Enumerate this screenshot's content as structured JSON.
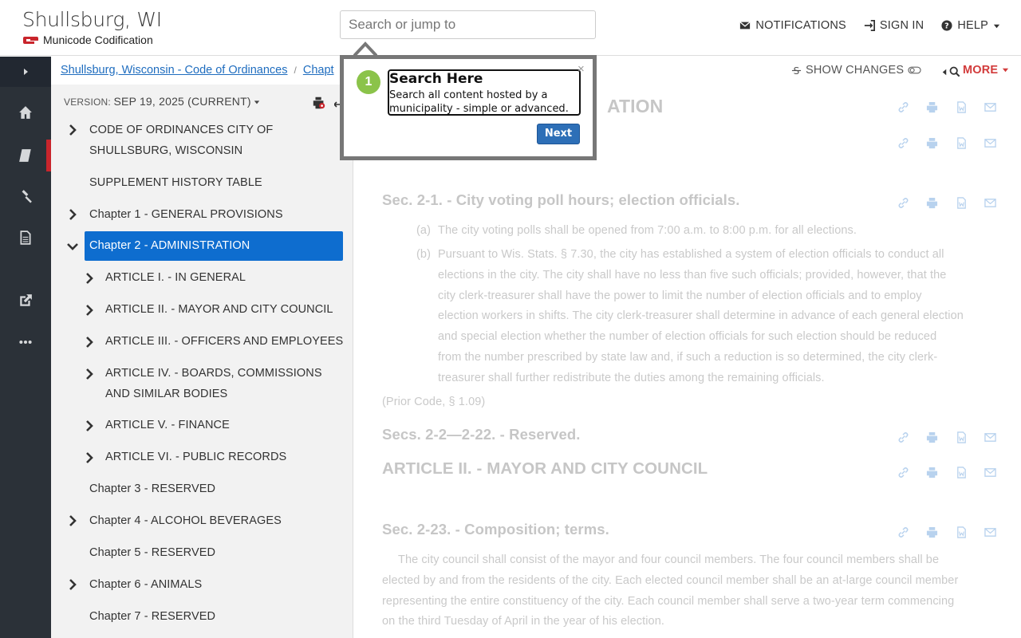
{
  "header": {
    "site_title": "Shullsburg, WI",
    "brand": "Municode Codification",
    "search_placeholder": "Search or jump to",
    "nav": {
      "notifications": "NOTIFICATIONS",
      "sign_in": "SIGN IN",
      "help": "HELP"
    }
  },
  "breadcrumb": {
    "root": "Shullsburg, Wisconsin - Code of Ordinances",
    "sep": "/",
    "current": "Chapt"
  },
  "toolbar": {
    "show_changes": "SHOW CHANGES",
    "more": "MORE"
  },
  "toc": {
    "version_label": "VERSION:",
    "version_value": "SEP 19, 2025 (CURRENT)",
    "items": [
      {
        "label_1": "CODE OF ORDINANCES CITY OF",
        "label_2": "SHULLSBURG, WISCONSIN"
      },
      {
        "label": "SUPPLEMENT HISTORY TABLE"
      },
      {
        "label": "Chapter 1 - GENERAL PROVISIONS"
      },
      {
        "label": "Chapter 2 - ADMINISTRATION"
      },
      {
        "label": "ARTICLE I. - IN GENERAL"
      },
      {
        "label": "ARTICLE II. - MAYOR AND CITY COUNCIL"
      },
      {
        "label": "ARTICLE III. - OFFICERS AND EMPLOYEES"
      },
      {
        "label_1": "ARTICLE IV. - BOARDS, COMMISSIONS",
        "label_2": "AND SIMILAR BODIES"
      },
      {
        "label": "ARTICLE V. - FINANCE"
      },
      {
        "label": "ARTICLE VI. - PUBLIC RECORDS"
      },
      {
        "label": "Chapter 3 - RESERVED"
      },
      {
        "label": "Chapter 4 - ALCOHOL BEVERAGES"
      },
      {
        "label": "Chapter 5 - RESERVED"
      },
      {
        "label": "Chapter 6 - ANIMALS"
      },
      {
        "label": "Chapter 7 - RESERVED"
      }
    ]
  },
  "document": {
    "chapter_title_fragment": "ATION",
    "sec_2_1_title": "Sec. 2-1. - City voting poll hours; election officials.",
    "sec_2_1_a_label": "(a)",
    "sec_2_1_a": "The city voting polls shall be opened from 7:00 a.m. to 8:00 p.m. for all elections.",
    "sec_2_1_b_label": "(b)",
    "sec_2_1_b_lines": [
      "Pursuant to Wis. Stats. § 7.30, the city has established a system of election officials to conduct all",
      "elections in the city. The city shall have no less than five such officials; provided, however, that the",
      "city clerk-treasurer shall have the power to limit the number of election officials and to employ",
      "election workers in shifts. The city clerk-treasurer shall determine in advance of each general election",
      "and special election whether the number of election officials for such election should be reduced",
      "from the number prescribed by state law and, if such a reduction is so determined, the city clerk-",
      "treasurer shall further redistribute the duties among the remaining officials."
    ],
    "prior_code": "(Prior Code, § 1.09)",
    "secs_reserved": "Secs. 2-2—2-22. - Reserved.",
    "article_ii": "ARTICLE II. - MAYOR AND CITY COUNCIL",
    "sec_2_23_title": "Sec. 2-23. - Composition; terms.",
    "sec_2_23_lines": [
      "The city council shall consist of the mayor and four council members. The four council members shall be",
      "elected by and from the residents of the city. Each elected council member shall be an at-large council member",
      "representing the entire constituency of the city. Each council member shall serve a two-year term commencing",
      "on the third Tuesday of April in the year of his election."
    ]
  },
  "tour": {
    "step": "1",
    "title": "Search Here",
    "text": "Search all content hosted by a municipality - simple or advanced.",
    "close": "×",
    "next": "Next"
  },
  "colors": {
    "rail_bg": "#2b3138",
    "accent_red": "#c9252c",
    "toc_active": "#0e6dcf",
    "tour_step": "#8bc34a",
    "tour_next": "#2d6fb7"
  }
}
